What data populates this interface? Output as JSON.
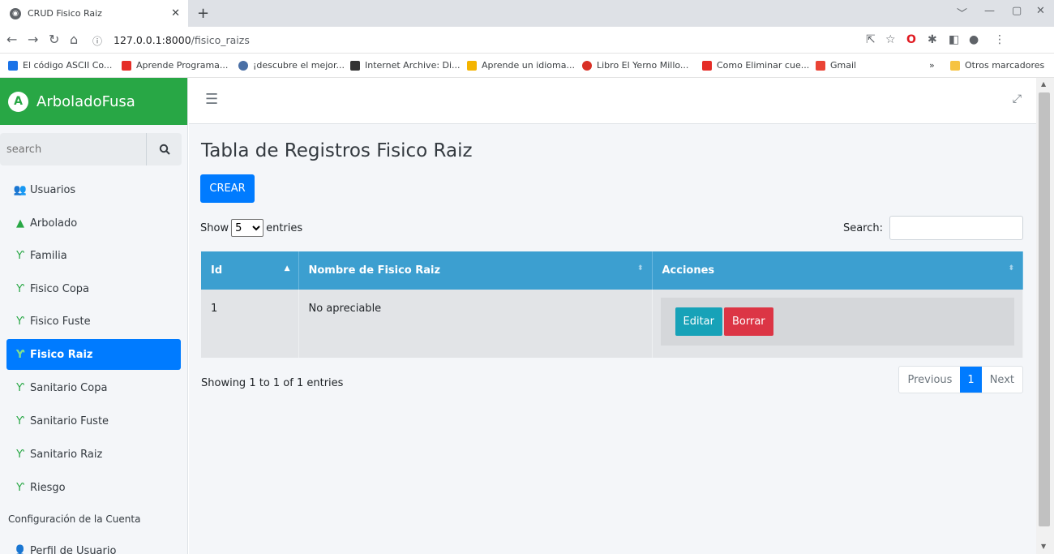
{
  "browser": {
    "tab_title": "CRUD Fisico Raiz",
    "url_host": "127.0.0.1:8000",
    "url_path": "/fisico_raizs",
    "bookmarks": [
      "El código ASCII Co...",
      "Aprende Programa...",
      "¡descubre el mejor...",
      "Internet Archive: Di...",
      "Aprende un idioma...",
      "Libro El Yerno Millo...",
      "Como Eliminar cue...",
      "Gmail"
    ],
    "other_bookmarks": "Otros marcadores"
  },
  "sidebar": {
    "brand": "ArboladoFusa",
    "search_placeholder": "search",
    "items": [
      {
        "label": "Usuarios",
        "icon": "users-icon"
      },
      {
        "label": "Arbolado",
        "icon": "tree-icon"
      },
      {
        "label": "Familia",
        "icon": "seedling-icon"
      },
      {
        "label": "Fisico Copa",
        "icon": "seedling-icon"
      },
      {
        "label": "Fisico Fuste",
        "icon": "seedling-icon"
      },
      {
        "label": "Fisico Raiz",
        "icon": "seedling-icon"
      },
      {
        "label": "Sanitario Copa",
        "icon": "seedling-icon"
      },
      {
        "label": "Sanitario Fuste",
        "icon": "seedling-icon"
      },
      {
        "label": "Sanitario Raiz",
        "icon": "seedling-icon"
      },
      {
        "label": "Riesgo",
        "icon": "seedling-icon"
      }
    ],
    "section_header": "Configuración de la Cuenta",
    "profile_label": "Perfil de Usuario",
    "active_color": "#007bff",
    "brand_color": "#28a745"
  },
  "main": {
    "title": "Tabla de Registros Fisico Raiz",
    "create_label": "CREAR",
    "show_label": "Show",
    "show_value": "5",
    "entries_label": "entries",
    "search_label": "Search:",
    "table": {
      "headers": [
        "Id",
        "Nombre de Fisico Raiz",
        "Acciones"
      ],
      "rows": [
        {
          "id": "1",
          "name": "No apreciable"
        }
      ],
      "edit_label": "Editar",
      "delete_label": "Borrar",
      "header_color": "#3c9fd0"
    },
    "info": "Showing 1 to 1 of 1 entries",
    "pagination": {
      "previous": "Previous",
      "current": "1",
      "next": "Next"
    }
  }
}
